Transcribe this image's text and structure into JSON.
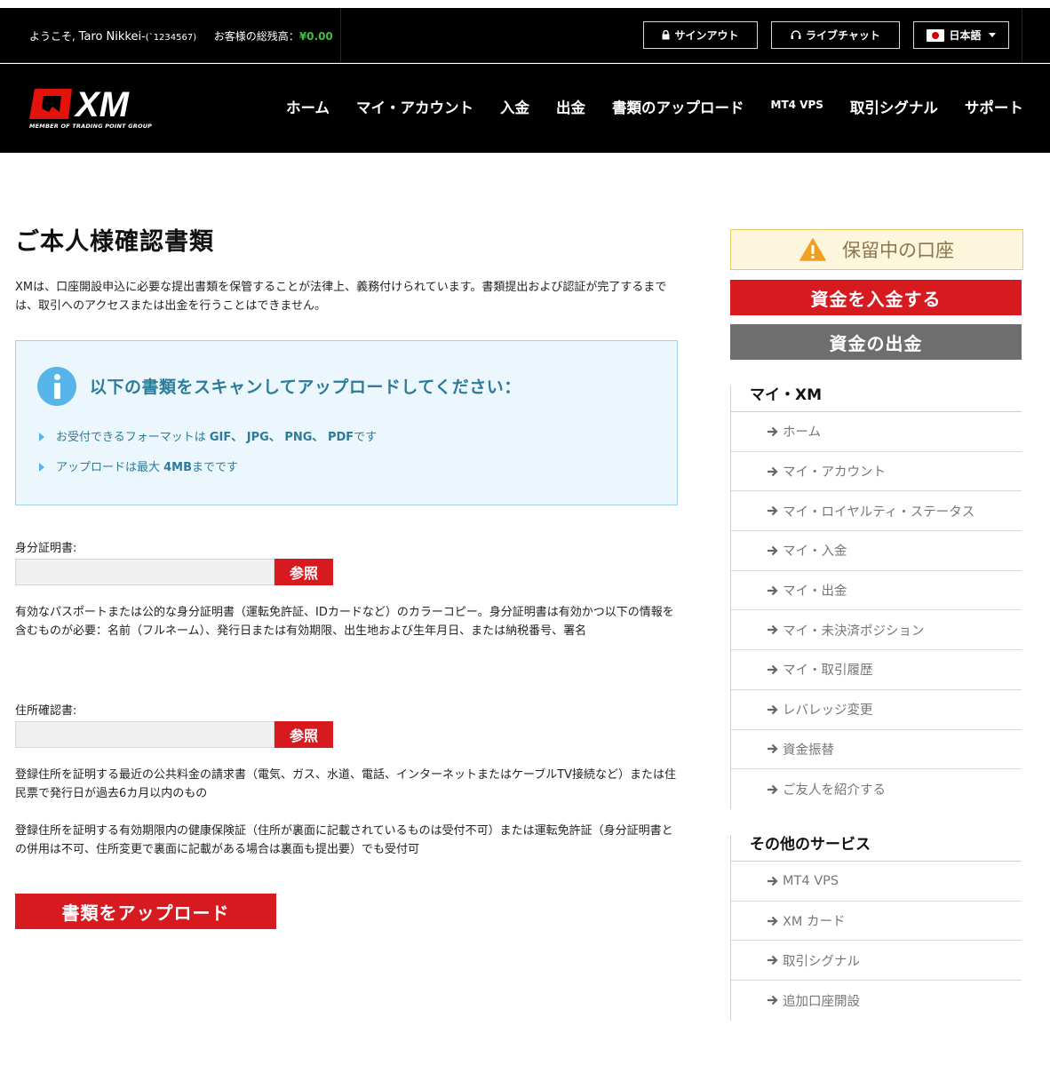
{
  "topbar": {
    "welcome_prefix": "ようこそ,",
    "user_name": "Taro Nikkei-",
    "user_id": "(`1234567)",
    "balance_label": "お客様の総残高：",
    "balance_value": "¥0.00",
    "signout_label": "サインアウト",
    "livechat_label": "ライブチャット",
    "language_label": "日本語"
  },
  "brand": {
    "logo_text": "XM",
    "logo_subtitle": "MEMBER OF TRADING POINT GROUP"
  },
  "nav": {
    "items": [
      "ホーム",
      "マイ・アカウント",
      "入金",
      "出金",
      "書類のアップロード",
      "MT4 VPS",
      "取引シグナル",
      "サポート"
    ]
  },
  "main": {
    "title": "ご本人様確認書類",
    "intro": "XMは、口座開設申込に必要な提出書類を保管することが法律上、義務付けられています。書類提出および認証が完了するまでは、取引へのアクセスまたは出金を行うことはできません。",
    "info": {
      "title": "以下の書類をスキャンしてアップロードしてください：",
      "item1_prefix": "お受付できるフォーマットは ",
      "item1_formats": "GIF、 JPG、 PNG、 PDF",
      "item1_suffix": "です",
      "item2_prefix": "アップロードは最大 ",
      "item2_size": "4MB",
      "item2_suffix": "までです"
    },
    "id_doc": {
      "label": "身分証明書:",
      "browse": "参照",
      "description": "有効なパスポートまたは公的な身分証明書（運転免許証、IDカードなど）のカラーコピー。身分証明書は有効かつ以下の情報を含むものが必要：名前（フルネーム）、発行日または有効期限、出生地および生年月日、または納税番号、署名"
    },
    "address_doc": {
      "label": "住所確認書:",
      "browse": "参照",
      "description1": "登録住所を証明する最近の公共料金の請求書（電気、ガス、水道、電話、インターネットまたはケーブルTV接続など）または住民票で発行日が過去6カ月以内のもの",
      "description2": "登録住所を証明する有効期限内の健康保険証（住所が裏面に記載されているものは受付不可）または運転免許証（身分証明書との併用は不可、住所変更で裏面に記載がある場合は裏面も提出要）でも受付可"
    },
    "upload_button": "書類をアップロード"
  },
  "sidebar": {
    "pending_label": "保留中の口座",
    "deposit_button": "資金を入金する",
    "withdraw_button": "資金の出金",
    "my_xm": {
      "title": "マイ・XM",
      "items": [
        "ホーム",
        "マイ・アカウント",
        "マイ・ロイヤルティ・ステータス",
        "マイ・入金",
        "マイ・出金",
        "マイ・未決済ポジション",
        "マイ・取引履歴",
        "レバレッジ変更",
        "資金振替",
        "ご友人を紹介する"
      ]
    },
    "other_services": {
      "title": "その他のサービス",
      "items": [
        "MT4 VPS",
        "XM カード",
        "取引シグナル",
        "追加口座開設"
      ]
    }
  },
  "colors": {
    "brand_red": "#d71920",
    "info_blue": "#2c7c99",
    "balance_green": "#3fbf3f",
    "pending_bg": "#fdf6dd"
  }
}
